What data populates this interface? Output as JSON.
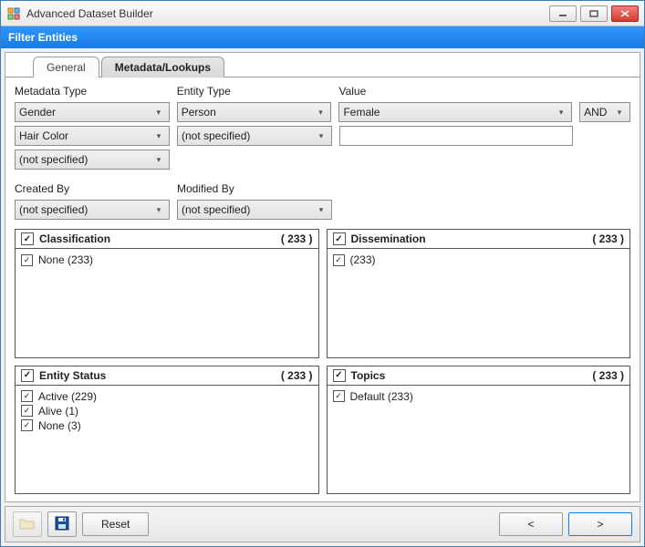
{
  "window": {
    "title": "Advanced Dataset Builder"
  },
  "strip": {
    "title": "Filter Entities"
  },
  "tabs": {
    "general": "General",
    "metadata": "Metadata/Lookups"
  },
  "labels": {
    "metadataType": "Metadata Type",
    "entityType": "Entity Type",
    "value": "Value",
    "createdBy": "Created By",
    "modifiedBy": "Modified By"
  },
  "rows": {
    "r1": {
      "meta": "Gender",
      "entity": "Person",
      "value": "Female",
      "op": "AND"
    },
    "r2": {
      "meta": "Hair Color",
      "entity": "(not specified)",
      "value": ""
    },
    "r3": {
      "meta": "(not specified)"
    }
  },
  "createdBy": "(not specified)",
  "modifiedBy": "(not specified)",
  "panels": {
    "classification": {
      "title": "Classification",
      "count": "( 233 )",
      "items": [
        {
          "label": "None (233)"
        }
      ]
    },
    "dissemination": {
      "title": "Dissemination",
      "count": "( 233 )",
      "items": [
        {
          "label": "(233)"
        }
      ]
    },
    "entityStatus": {
      "title": "Entity Status",
      "count": "( 233 )",
      "items": [
        {
          "label": "Active (229)"
        },
        {
          "label": "Alive (1)"
        },
        {
          "label": "None (3)"
        }
      ]
    },
    "topics": {
      "title": "Topics",
      "count": "( 233 )",
      "items": [
        {
          "label": "Default (233)"
        }
      ]
    }
  },
  "footer": {
    "reset": "Reset",
    "prev": "<",
    "next": ">"
  }
}
